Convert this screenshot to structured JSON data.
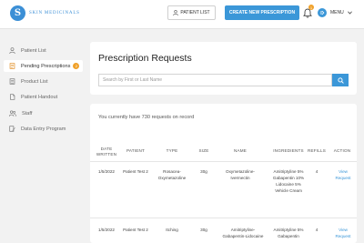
{
  "header": {
    "logo_letter": "S",
    "logo_text": "SKIN MEDICINALS",
    "patient_list_label": "PATIENT LIST",
    "new_prescription_label": "CREATE NEW PRESCRIPTION",
    "notification_count": "1",
    "menu_label": "MENU"
  },
  "sidebar": {
    "items": [
      {
        "label": "Patient List",
        "icon": "patient-list-icon"
      },
      {
        "label": "Pending Prescriptions",
        "icon": "prescription-icon",
        "badge": "2"
      },
      {
        "label": "Product List",
        "icon": "product-list-icon"
      },
      {
        "label": "Patient Handout",
        "icon": "handout-icon"
      },
      {
        "label": "Staff",
        "icon": "staff-icon"
      },
      {
        "label": "Data Entry Program",
        "icon": "data-entry-icon"
      }
    ]
  },
  "main": {
    "title": "Prescription Requests",
    "search_placeholder": "Search by First or Last Name",
    "record_count_text": "You currently have 730 requests on record",
    "columns": [
      "DATE WRITTEN",
      "PATIENT",
      "TYPE",
      "SIZE",
      "NAME",
      "INGREDIENTS",
      "REFILLS",
      "ACTION"
    ],
    "rows": [
      {
        "date": "1/5/2022",
        "patient": "Patient Test 2",
        "type": "Rosacea-Oxymetazoline",
        "size": "30g",
        "name": "Oxymetazoline-Ivermectin",
        "ingredients": "Amitriptyline 5% Gabapentin 10% Lidocaine 5% Vehicle Cream",
        "refills": "4",
        "action": "View Request"
      },
      {
        "date": "1/5/2022",
        "patient": "Patient Test 2",
        "type": "Itching",
        "size": "30g",
        "name": "Amitriptyline-Gabapentin-Lidocaine",
        "ingredients": "Amitriptyline 5% Gabapentin",
        "refills": "4",
        "action": "View Request"
      }
    ]
  },
  "colors": {
    "accent": "#3b97d8",
    "badge": "#f0a12a",
    "background": "#f2f2f2"
  }
}
